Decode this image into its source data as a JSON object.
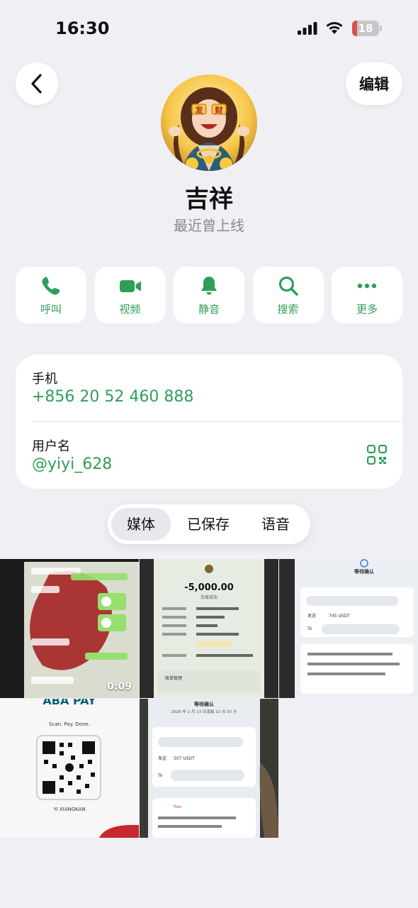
{
  "status_bar": {
    "time": "16:30",
    "battery": "18",
    "battery_level": 0.18,
    "battery_color": "#d9524b"
  },
  "header": {
    "edit_label": "编辑"
  },
  "avatar": {
    "badge_left": "发",
    "badge_right": "财"
  },
  "profile": {
    "name": "吉祥",
    "status": "最近曾上线"
  },
  "actions": [
    {
      "icon": "phone-icon",
      "label": "呼叫"
    },
    {
      "icon": "video-icon",
      "label": "视频"
    },
    {
      "icon": "bell-icon",
      "label": "静音"
    },
    {
      "icon": "search-icon",
      "label": "搜索"
    },
    {
      "icon": "more-icon",
      "label": "更多"
    }
  ],
  "info": {
    "phone_label": "手机",
    "phone_value": "+856 20 52 460 888",
    "username_label": "用户名",
    "username_value": "@yiyi_628"
  },
  "tabs": [
    {
      "label": "媒体",
      "active": true
    },
    {
      "label": "已保存",
      "active": false
    },
    {
      "label": "语音",
      "active": false
    }
  ],
  "media": {
    "video_duration": "0:09",
    "tile2": {
      "amount": "-5,000.00",
      "caption": "交易成功",
      "footer": "账单管理"
    },
    "tile3": {
      "title": "等待确认",
      "send": "发送",
      "amount": "745 USDT",
      "to": "To"
    },
    "tile4": {
      "brand": "ABA PAY",
      "tagline": "Scan. Pay. Done.",
      "holder": "YI XIANGKAN"
    },
    "tile5": {
      "title": "等待确认",
      "subtitle": "2026 年 2 月 13 日凌晨 12 点 55 分",
      "send": "发送",
      "amount": "507 USDT",
      "to": "To",
      "network": "Tron"
    }
  },
  "colors": {
    "accent": "#2f9e5a",
    "background": "#f0eff4",
    "card": "#ffffff"
  }
}
